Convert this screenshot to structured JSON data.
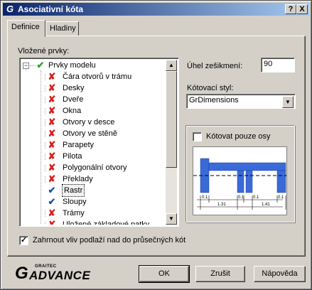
{
  "window": {
    "title": "Asociativní kóta",
    "help_label": "?",
    "close_label": "X",
    "logo_glyph": "G"
  },
  "tabs": [
    {
      "label": "Definice",
      "active": true
    },
    {
      "label": "Hladiny",
      "active": false
    }
  ],
  "inserted": {
    "label": "Vložené prvky:",
    "root": {
      "label": "Prvky modelu",
      "icon": "check-icon",
      "expanded": true
    },
    "items": [
      {
        "label": "Čára otvorů v trámu",
        "icon": "x-icon"
      },
      {
        "label": "Desky",
        "icon": "x-icon"
      },
      {
        "label": "Dveře",
        "icon": "x-icon"
      },
      {
        "label": "Okna",
        "icon": "x-icon"
      },
      {
        "label": "Otvory v desce",
        "icon": "x-icon"
      },
      {
        "label": "Otvory ve stěně",
        "icon": "x-icon"
      },
      {
        "label": "Parapety",
        "icon": "x-icon"
      },
      {
        "label": "Pilota",
        "icon": "x-icon"
      },
      {
        "label": "Polygonální otvory",
        "icon": "x-icon"
      },
      {
        "label": "Překlady",
        "icon": "x-icon"
      },
      {
        "label": "Rastr",
        "icon": "check-icon",
        "selected": true
      },
      {
        "label": "Sloupy",
        "icon": "check-icon"
      },
      {
        "label": "Trámy",
        "icon": "x-icon"
      },
      {
        "label": "Uložené základové patky",
        "icon": "x-icon"
      }
    ]
  },
  "angle": {
    "label": "Úhel zešikmení:",
    "value": "90"
  },
  "dim_style": {
    "label": "Kótovací styl:",
    "value": "GrDimensions"
  },
  "axes_only": {
    "label": "Kótovat pouze osy",
    "checked": false
  },
  "preview": {
    "dim_labels": [
      "0.1",
      "0.1",
      "0.1",
      "0.1"
    ],
    "totals": [
      "1.31",
      "1.41"
    ]
  },
  "include_levels": {
    "label": "Zahrnout vliv podlaží nad do průsečných kót",
    "checked": true
  },
  "brand": {
    "small": "GRAITEC",
    "big": "ADVANCE",
    "g": "G"
  },
  "buttons": {
    "ok": "OK",
    "cancel": "Zrušit",
    "help": "Nápověda"
  },
  "colors": {
    "title_start": "#0a246a",
    "title_end": "#a6caf0",
    "x_red": "#d82020",
    "check_blue": "#1a50b0",
    "check_green": "#2e9e2e",
    "preview_blue": "#3a6ad8"
  }
}
